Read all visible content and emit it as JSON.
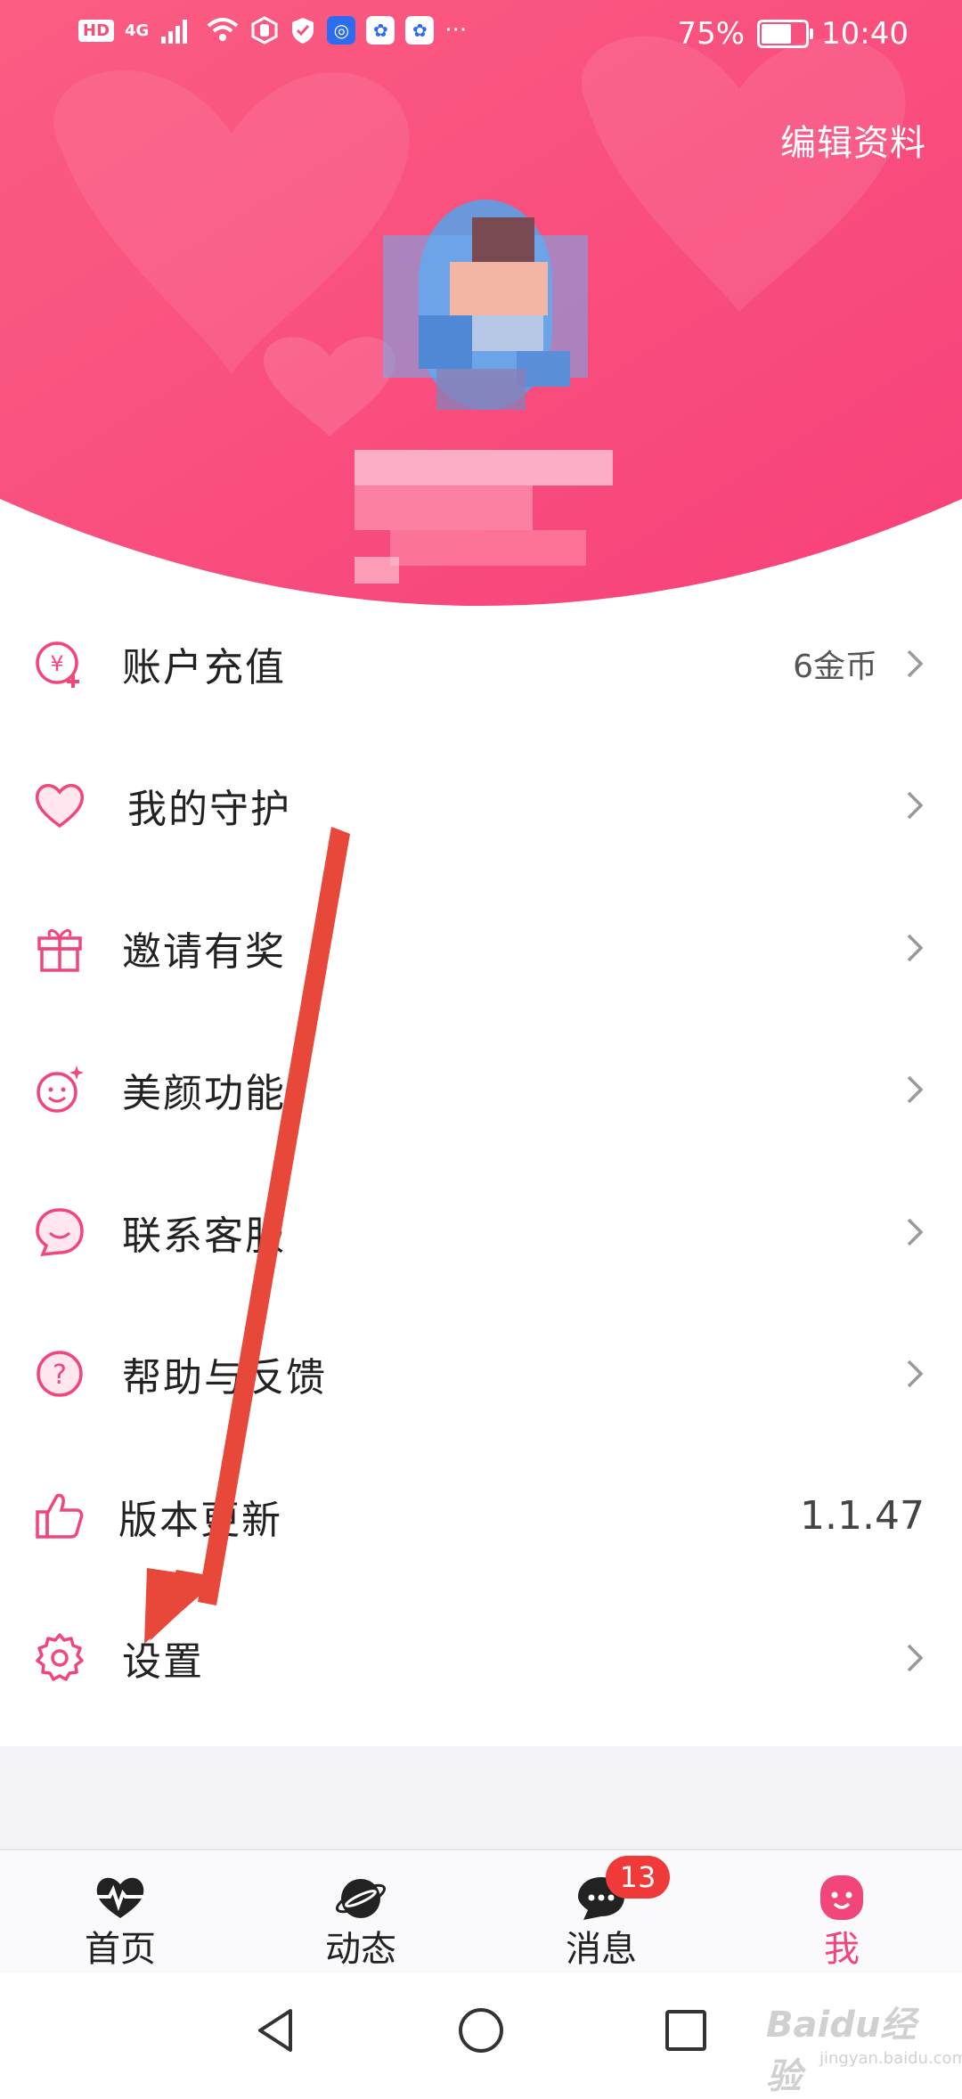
{
  "status_bar": {
    "network": "4G",
    "battery": "75%",
    "battery_level": 0.75,
    "time": "10:40"
  },
  "header": {
    "edit_profile": "编辑资料"
  },
  "menu": [
    {
      "label": "账户充值",
      "value": "6金币",
      "icon": "yuan-coin-icon"
    },
    {
      "label": "我的守护",
      "value": "",
      "icon": "heart-icon"
    },
    {
      "label": "邀请有奖",
      "value": "",
      "icon": "gift-icon"
    },
    {
      "label": "美颜功能",
      "value": "",
      "icon": "beauty-face-icon"
    },
    {
      "label": "联系客服",
      "value": "",
      "icon": "customer-service-icon"
    },
    {
      "label": "帮助与反馈",
      "value": "",
      "icon": "help-icon"
    },
    {
      "label": "版本更新",
      "value": "1.1.47",
      "icon": "thumbs-up-icon"
    },
    {
      "label": "设置",
      "value": "",
      "icon": "gear-icon"
    }
  ],
  "tabs": [
    {
      "label": "首页",
      "icon": "heartbeat-icon",
      "active": false
    },
    {
      "label": "动态",
      "icon": "planet-icon",
      "active": false
    },
    {
      "label": "消息",
      "icon": "chat-bubble-icon",
      "active": false,
      "badge": "13"
    },
    {
      "label": "我",
      "icon": "me-face-icon",
      "active": true
    }
  ],
  "colors": {
    "brand_pink": "#f2457a",
    "header_gradient_start": "#fb5d82",
    "header_gradient_end": "#f7417a",
    "badge_red": "#f03a3a",
    "annotation_arrow": "#e8483a"
  },
  "watermark": {
    "text": "Baidu经验",
    "sub": "jingyan.baidu.com"
  }
}
